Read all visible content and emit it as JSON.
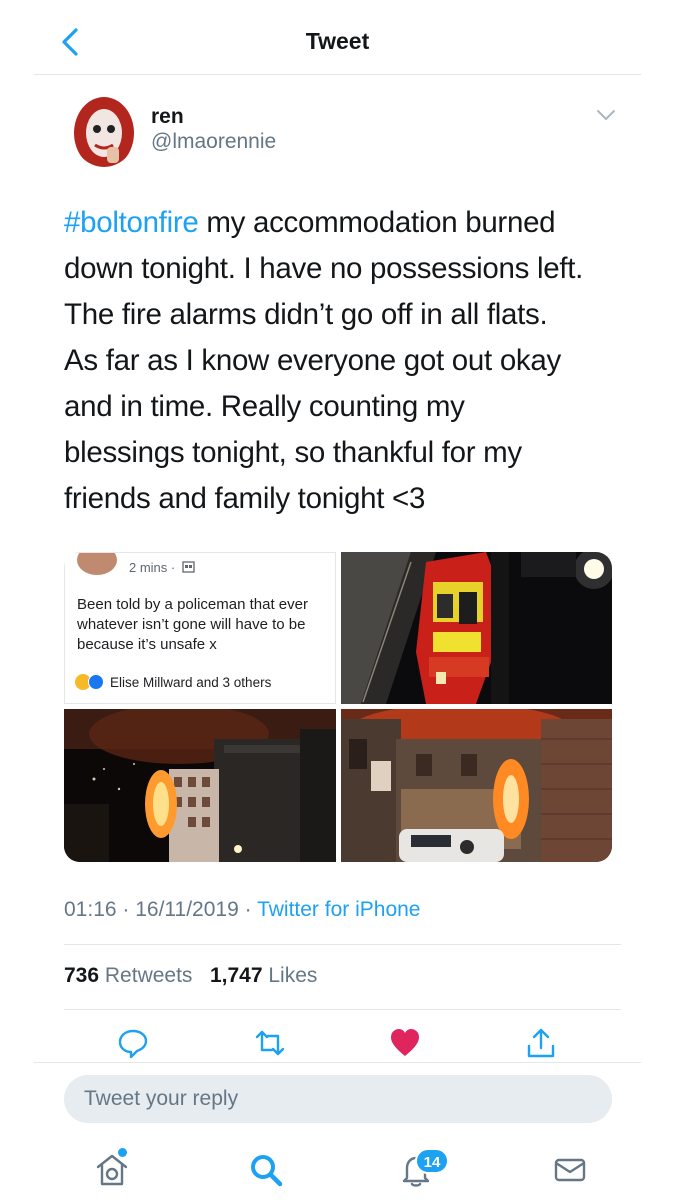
{
  "header": {
    "title": "Tweet",
    "back_icon": "chevron-left-icon"
  },
  "author": {
    "name": "ren",
    "handle": "@lmaorennie"
  },
  "tweet": {
    "hashtag": "#boltonfire",
    "lines": [
      " my accommodation burned",
      "down tonight. I have no possessions left.",
      "The fire alarms didn’t go off in all flats.",
      "As far as I know everyone got out okay",
      "and in time. Really counting my",
      "blessings tonight, so thankful for my",
      "friends and family tonight <3"
    ]
  },
  "media": {
    "screenshot": {
      "time": "2 mins ·",
      "lines": [
        "Been told by a policeman that ever",
        "whatever isn’t gone will have to be",
        "because it’s unsafe x"
      ],
      "reactions": "Elise Millward and 3 others"
    }
  },
  "meta": {
    "time": "01:16",
    "sep1": " · ",
    "date": "16/11/2019",
    "sep2": " · ",
    "source": "Twitter for iPhone"
  },
  "stats": {
    "retweets_count": "736",
    "retweets_label": "Retweets",
    "likes_count": "1,747",
    "likes_label": "Likes"
  },
  "reply": {
    "placeholder": "Tweet your reply"
  },
  "tabbar": {
    "notifications_badge": "14"
  },
  "colors": {
    "accent": "#1da1f2",
    "like": "#e0245e",
    "text": "#14171a",
    "secondary": "#657786"
  }
}
